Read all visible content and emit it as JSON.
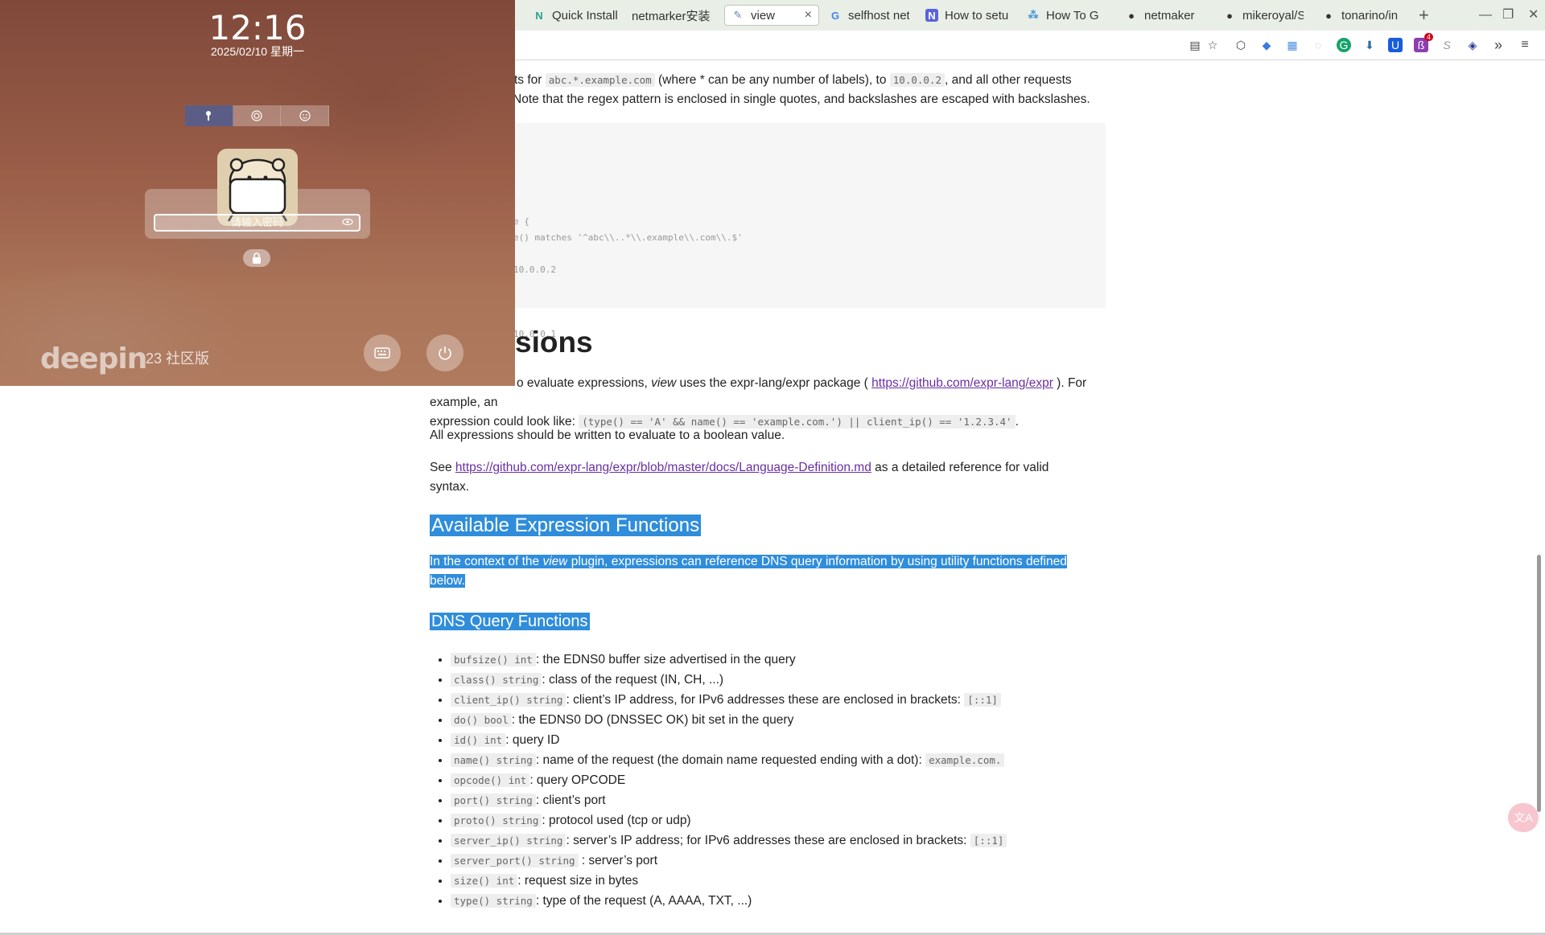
{
  "browser": {
    "tabs": [
      {
        "label": "Quick Install",
        "icon": "N",
        "color": "#2aa189"
      },
      {
        "label": "netmarker安装",
        "icon": "",
        "color": ""
      },
      {
        "label": "view",
        "icon": "✎",
        "color": "#6a7fb0",
        "active": true
      },
      {
        "label": "selfhost net",
        "icon": "G",
        "color": "#4285f4"
      },
      {
        "label": "How to setu",
        "icon": "N",
        "color": "#5864d9"
      },
      {
        "label": "How To G",
        "icon": "⁂",
        "color": "#3a8cd6"
      },
      {
        "label": "netmaker",
        "icon": "●",
        "color": "#333333"
      },
      {
        "label": "mikeroyal/S",
        "icon": "●",
        "color": "#333333"
      },
      {
        "label": "tonarino/in",
        "icon": "●",
        "color": "#333333"
      }
    ],
    "new_tab": "+",
    "tab_close": "×",
    "win_minimize": "—",
    "win_restore": "❐",
    "win_close": "✕",
    "toolbar_badge": "4"
  },
  "page": {
    "intro_line1_a": "ts for ",
    "intro_code1": "abc.*.example.com",
    "intro_line1_b": " (where * can be any number of labels), to ",
    "intro_code2": "10.0.0.2",
    "intro_line1_c": ", and all other requests",
    "intro_line2": "Note that the regex pattern is enclosed in single quotes, and backslashes are escaped with backslashes.",
    "codeblock": [
      "e {",
      "e() matches '^abc\\\\..*\\\\.example\\\\.com\\\\.$'",
      "10.0.0.2",
      "10.0.0.1"
    ],
    "section_heading": "sions",
    "expr_p1_a": "o evaluate expressions, ",
    "expr_p1_em": "view",
    "expr_p1_b": " uses the expr-lang/expr package ( ",
    "expr_p1_link": "https://github.com/expr-lang/expr",
    "expr_p1_c": " ). For example, an",
    "expr_p1_d": "expression could look like: ",
    "expr_p1_code": "(type() == 'A' && name() == 'example.com.') || client_ip() == '1.2.3.4'",
    "expr_p1_e": ".",
    "expr_p2": "All expressions should be written to evaluate to a boolean value.",
    "expr_p3_a": "See ",
    "expr_p3_link": "https://github.com/expr-lang/expr/blob/master/docs/Language-Definition.md",
    "expr_p3_b": " as a detailed reference for valid",
    "expr_p3_c": "syntax.",
    "h3_available": "Available Expression Functions",
    "avail_p_a": "In the context of the ",
    "avail_p_em": "view",
    "avail_p_b": " plugin, expressions can reference DNS query information by using utility functions defined",
    "avail_p_c": "below.",
    "h4_dns": "DNS Query Functions",
    "functions": [
      {
        "code": "bufsize() int",
        "desc": ": the EDNS0 buffer size advertised in the query",
        "extra": ""
      },
      {
        "code": "class() string",
        "desc": ": class of the request (IN, CH, ...)",
        "extra": ""
      },
      {
        "code": "client_ip() string",
        "desc": ": client’s IP address, for IPv6 addresses these are enclosed in brackets: ",
        "extra": "[::1]"
      },
      {
        "code": "do() bool",
        "desc": ": the EDNS0 DO (DNSSEC OK) bit set in the query",
        "extra": ""
      },
      {
        "code": "id() int",
        "desc": ": query ID",
        "extra": ""
      },
      {
        "code": "name() string",
        "desc": ": name of the request (the domain name requested ending with a dot): ",
        "extra": "example.com."
      },
      {
        "code": "opcode() int",
        "desc": ": query OPCODE",
        "extra": ""
      },
      {
        "code": "port() string",
        "desc": ": client’s port",
        "extra": ""
      },
      {
        "code": "proto() string",
        "desc": ": protocol used (tcp or udp)",
        "extra": ""
      },
      {
        "code": "server_ip() string",
        "desc": ": server’s IP address; for IPv6 addresses these are enclosed in brackets: ",
        "extra": "[::1]"
      },
      {
        "code": "server_port() string",
        "desc": " : server’s port",
        "extra": ""
      },
      {
        "code": "size() int",
        "desc": ": request size in bytes",
        "extra": ""
      },
      {
        "code": "type() string",
        "desc": ": type of the request (A, AAAA, TXT, ...)",
        "extra": ""
      }
    ]
  },
  "lockscreen": {
    "time": "12:16",
    "date": "2025/02/10 星期一",
    "password_placeholder": "请输入密码",
    "logo": "deepin",
    "edition": "23 社区版"
  }
}
